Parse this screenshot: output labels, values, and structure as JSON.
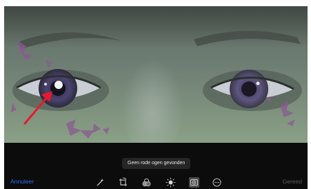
{
  "status_message": "Geen rode ogen gevonden",
  "toolbar": {
    "cancel_label": "Annuleer",
    "done_label": "Gereed",
    "tools": [
      {
        "icon": "magic-wand-icon",
        "active": false
      },
      {
        "icon": "crop-rotate-icon",
        "active": false
      },
      {
        "icon": "filters-icon",
        "active": false
      },
      {
        "icon": "adjust-light-icon",
        "active": false
      },
      {
        "icon": "red-eye-icon",
        "active": true
      },
      {
        "icon": "more-icon",
        "active": false
      }
    ]
  },
  "colors": {
    "accent": "#2f6cf0",
    "annotation_arrow": "#e8192c",
    "toolbar_background": "#0c0c0c",
    "disabled_text": "#5a5a5a"
  }
}
